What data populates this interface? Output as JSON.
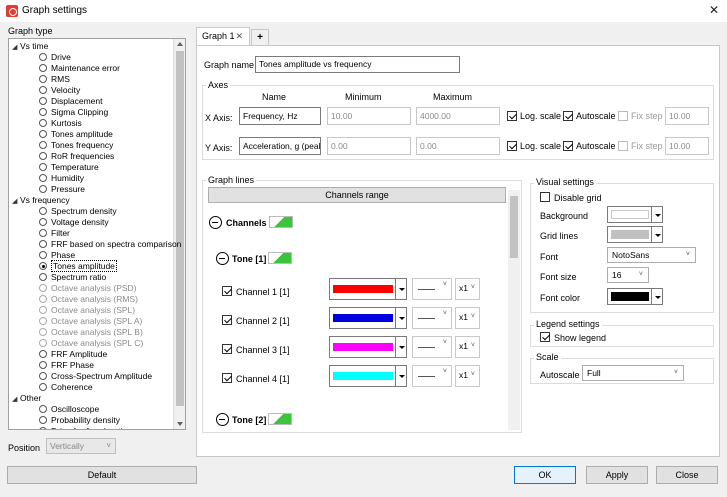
{
  "window": {
    "title": "Graph settings",
    "close_glyph": "✕"
  },
  "left": {
    "group_label": "Graph type",
    "tree": [
      {
        "kind": "group",
        "label": "Vs time",
        "expanded": true
      },
      {
        "kind": "item",
        "label": "Drive"
      },
      {
        "kind": "item",
        "label": "Maintenance error"
      },
      {
        "kind": "item",
        "label": "RMS"
      },
      {
        "kind": "item",
        "label": "Velocity"
      },
      {
        "kind": "item",
        "label": "Displacement"
      },
      {
        "kind": "item",
        "label": "Sigma Clipping"
      },
      {
        "kind": "item",
        "label": "Kurtosis"
      },
      {
        "kind": "item",
        "label": "Tones amplitude"
      },
      {
        "kind": "item",
        "label": "Tones frequency"
      },
      {
        "kind": "item",
        "label": "RoR frequencies"
      },
      {
        "kind": "item",
        "label": "Temperature"
      },
      {
        "kind": "item",
        "label": "Humidity"
      },
      {
        "kind": "item",
        "label": "Pressure"
      },
      {
        "kind": "group",
        "label": "Vs frequency",
        "expanded": true
      },
      {
        "kind": "item",
        "label": "Spectrum density"
      },
      {
        "kind": "item",
        "label": "Voltage density"
      },
      {
        "kind": "item",
        "label": "Filter"
      },
      {
        "kind": "item",
        "label": "FRF based on spectra comparison"
      },
      {
        "kind": "item",
        "label": "Phase"
      },
      {
        "kind": "item",
        "label": "Tones amplitude",
        "selected": true
      },
      {
        "kind": "item",
        "label": "Spectrum ratio"
      },
      {
        "kind": "item",
        "label": "Octave analysis (PSD)",
        "disabled": true
      },
      {
        "kind": "item",
        "label": "Octave analysis (RMS)",
        "disabled": true
      },
      {
        "kind": "item",
        "label": "Octave analysis (SPL)",
        "disabled": true
      },
      {
        "kind": "item",
        "label": "Octave analysis (SPL A)",
        "disabled": true
      },
      {
        "kind": "item",
        "label": "Octave analysis (SPL B)",
        "disabled": true
      },
      {
        "kind": "item",
        "label": "Octave analysis (SPL C)",
        "disabled": true
      },
      {
        "kind": "item",
        "label": "FRF Amplitude"
      },
      {
        "kind": "item",
        "label": "FRF Phase"
      },
      {
        "kind": "item",
        "label": "Cross-Spectrum Amplitude"
      },
      {
        "kind": "item",
        "label": "Coherence"
      },
      {
        "kind": "group",
        "label": "Other",
        "expanded": true
      },
      {
        "kind": "item",
        "label": "Oscilloscope"
      },
      {
        "kind": "item",
        "label": "Probability density"
      },
      {
        "kind": "item",
        "label": "Drive for Acceleration"
      }
    ],
    "position_label": "Position",
    "position_value": "Vertically",
    "default_button": "Default"
  },
  "tabs": [
    {
      "label": "Graph 1",
      "close": "✕"
    },
    {
      "label": "+"
    }
  ],
  "graph_name": {
    "label": "Graph name",
    "value": "Tones amplitude vs frequency"
  },
  "axes": {
    "legend": "Axes",
    "col_name": "Name",
    "col_min": "Minimum",
    "col_max": "Maximum",
    "x": {
      "label": "X Axis:",
      "name": "Frequency, Hz",
      "min": "10.00",
      "max": "4000.00",
      "log_label": "Log. scale",
      "log": true,
      "auto_label": "Autoscale",
      "auto": true,
      "fix_label": "Fix step",
      "fix": false,
      "step": "10.00"
    },
    "y": {
      "label": "Y Axis:",
      "name": "Acceleration, g (peak)",
      "min": "0.00",
      "max": "0.00",
      "log_label": "Log. scale",
      "log": true,
      "auto_label": "Autoscale",
      "auto": true,
      "fix_label": "Fix step",
      "fix": false,
      "step": "10.00"
    }
  },
  "graph_lines": {
    "legend": "Graph lines",
    "channels_range_button": "Channels range",
    "channels_label": "Channels",
    "tone1_label": "Tone [1]",
    "channels": [
      {
        "label": "Channel 1 [1]",
        "color": "#ff0000",
        "multiplier": "x1",
        "checked": true
      },
      {
        "label": "Channel 2 [1]",
        "color": "#0000e0",
        "multiplier": "x1",
        "checked": true
      },
      {
        "label": "Channel 3 [1]",
        "color": "#ff00ff",
        "multiplier": "x1",
        "checked": true
      },
      {
        "label": "Channel 4 [1]",
        "color": "#00ffff",
        "multiplier": "x1",
        "checked": true
      }
    ],
    "tone2_label": "Tone [2]"
  },
  "visual": {
    "legend": "Visual settings",
    "disable_grid_label": "Disable grid",
    "disable_grid": false,
    "background_label": "Background",
    "background_color": "#ffffff",
    "grid_lines_label": "Grid lines",
    "grid_lines_color": "#c0c0c0",
    "font_label": "Font",
    "font_value": "NotoSans",
    "font_size_label": "Font size",
    "font_size_value": "16",
    "font_color_label": "Font color",
    "font_color": "#000000"
  },
  "legend_settings": {
    "legend": "Legend settings",
    "show_legend_label": "Show legend",
    "show_legend": true
  },
  "scale": {
    "legend": "Scale",
    "autoscale_label": "Autoscale",
    "autoscale_value": "Full"
  },
  "buttons": {
    "ok": "OK",
    "apply": "Apply",
    "close": "Close"
  }
}
